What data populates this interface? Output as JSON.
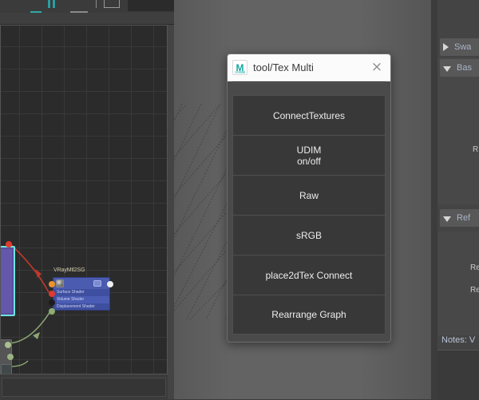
{
  "window": {
    "app": "Maya",
    "toolbar_icons": [
      "toolbar-icon-1",
      "toolbar-icon-2",
      "toolbar-icon-3",
      "toolbar-icon-4",
      "toolbar-icon-5",
      "toolbar-icon-6"
    ]
  },
  "node_editor": {
    "nodes": [
      {
        "name": "VRayMtl2SG",
        "label": "VRayMtl2SG",
        "attributes": [
          "Surface Shader",
          "Volume Shader",
          "Displacement Shader"
        ],
        "ports": [
          "orange",
          "red",
          "black",
          "green",
          "white-out"
        ]
      },
      {
        "name": "purple-node",
        "label": ""
      }
    ]
  },
  "dialog": {
    "title": "tool/Tex Multi",
    "icon": "maya-icon",
    "close_label": "×",
    "buttons": [
      {
        "id": "connect-textures",
        "label": "ConnectTextures"
      },
      {
        "id": "udim-on-off",
        "label": "UDIM\non/off"
      },
      {
        "id": "raw",
        "label": "Raw"
      },
      {
        "id": "srgb",
        "label": "sRGB"
      },
      {
        "id": "place2dtex-connect",
        "label": "place2dTex Connect"
      },
      {
        "id": "rearrange-graph",
        "label": "Rearrange Graph"
      }
    ]
  },
  "attribute_panel": {
    "sections": [
      {
        "id": "swatch",
        "label": "Swa",
        "expanded": false,
        "arrow": "triangle-right-icon"
      },
      {
        "id": "basic",
        "label": "Bas",
        "expanded": true,
        "arrow": "triangle-down-icon"
      },
      {
        "id": "reflection",
        "label": "Ref",
        "expanded": true,
        "arrow": "triangle-down-icon"
      }
    ],
    "field_labels": [
      "R",
      "Re",
      "Re"
    ],
    "notes_label": "Notes:  V"
  },
  "colors": {
    "dialog_bg": "#4a4a4a",
    "button_bg": "#383838",
    "titlebar_bg": "#fbfbfb",
    "viewport_bg": "#636363",
    "node_editor_bg": "#2b2b2b",
    "maya_teal": "#16a6a0",
    "node_blue": "#3f4fa0",
    "node_purple": "#5a4f9e",
    "selection_cyan": "#6ee3e0",
    "section_label": "#aab4c8"
  }
}
